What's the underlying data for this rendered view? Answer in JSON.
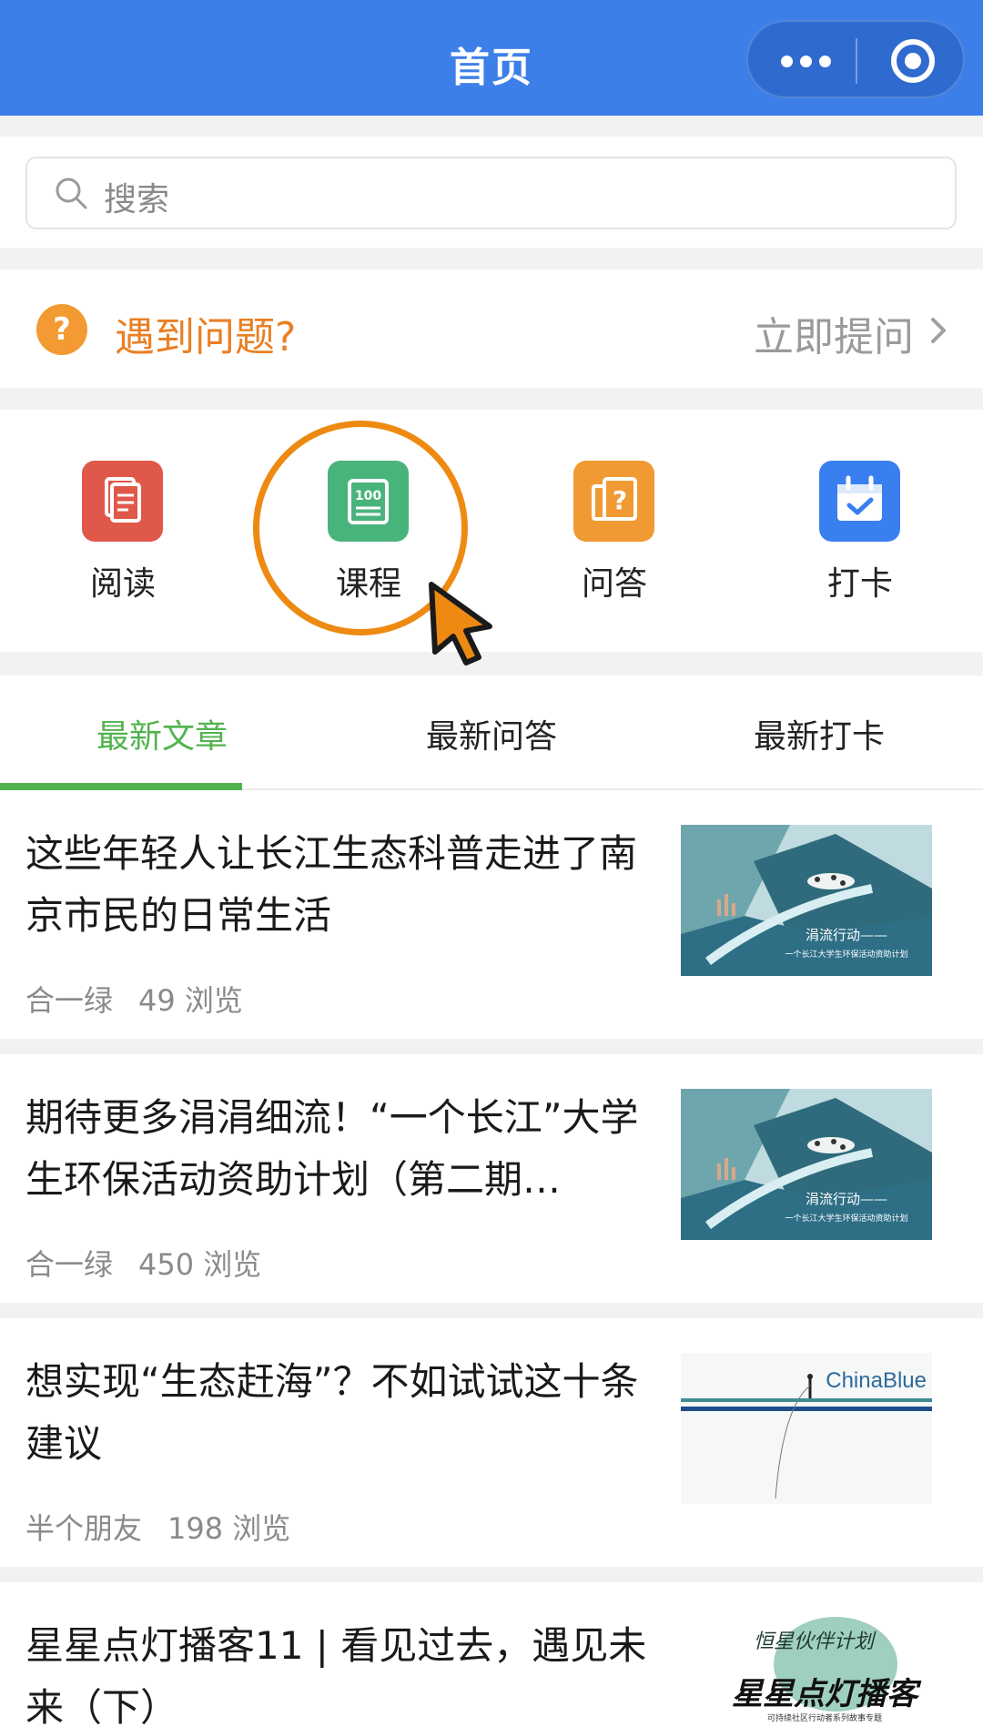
{
  "header": {
    "title": "首页"
  },
  "search": {
    "placeholder": "搜索"
  },
  "problem_bar": {
    "question_mark": "?",
    "text": "遇到问题?",
    "action_label": "立即提问"
  },
  "grid": [
    {
      "label": "阅读",
      "icon": "reading-icon",
      "color": "#e0584a"
    },
    {
      "label": "课程",
      "icon": "course-100-icon",
      "color": "#49b37c",
      "icon_text": "100"
    },
    {
      "label": "问答",
      "icon": "qa-icon",
      "color": "#f19a33"
    },
    {
      "label": "打卡",
      "icon": "checkin-calendar-icon",
      "color": "#3a7ff0"
    }
  ],
  "tabs": [
    {
      "label": "最新文章",
      "active": true
    },
    {
      "label": "最新问答",
      "active": false
    },
    {
      "label": "最新打卡",
      "active": false
    }
  ],
  "articles": [
    {
      "title": "这些年轻人让长江生态科普走进了南京市民的日常生活",
      "author": "合一绿",
      "views": "49 浏览",
      "thumb_caption": "涓流行动——",
      "thumb_sub": "一个长江大学生环保活动资助计划"
    },
    {
      "title": "期待更多涓涓细流！“一个长江”大学生环保活动资助计划（第二期…",
      "author": "合一绿",
      "views": "450 浏览",
      "thumb_caption": "涓流行动——",
      "thumb_sub": "一个长江大学生环保活动资助计划"
    },
    {
      "title": "想实现“生态赶海”？不如试试这十条建议",
      "author": "半个朋友",
      "views": "198 浏览",
      "thumb_caption": "ChinaBlue"
    },
    {
      "title": "星星点灯播客11 | 看见过去，遇见未来（下）",
      "thumb_caption": "恒星伙伴计划",
      "thumb_sub": "星星点灯播客",
      "thumb_small": "可持续社区行动者系列故事专题"
    }
  ],
  "colors": {
    "header_bg": "#3d7fe8",
    "accent_green": "#52b34e",
    "question_orange": "#ea7f24",
    "highlight_orange": "#ee8a12"
  }
}
